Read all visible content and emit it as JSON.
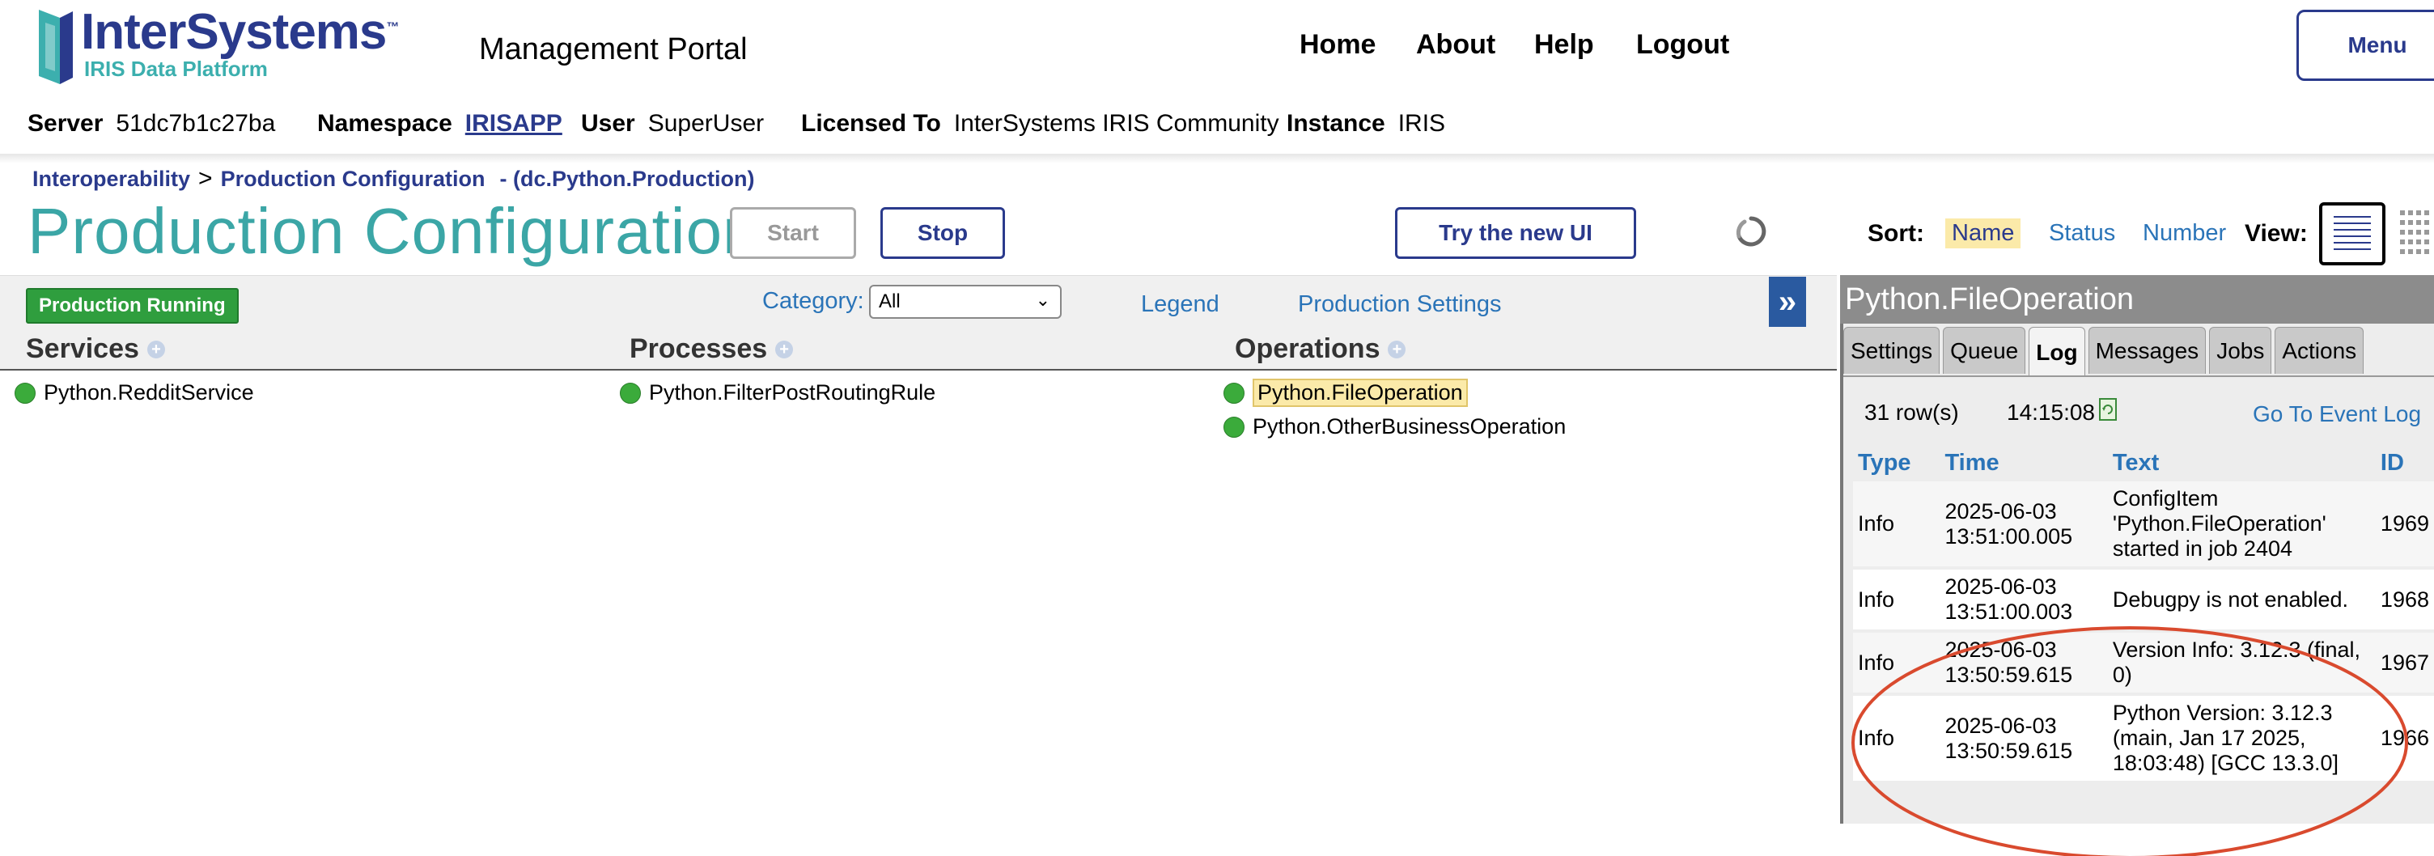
{
  "brand": {
    "name": "InterSystems",
    "tm": "™",
    "subtitle": "IRIS Data Platform",
    "portal_title": "Management Portal"
  },
  "topnav": [
    "Home",
    "About",
    "Help",
    "Logout"
  ],
  "menu_label": "Menu",
  "info": {
    "server_label": "Server",
    "server": "51dc7b1c27ba",
    "namespace_label": "Namespace",
    "namespace": "IRISAPP",
    "user_label": "User",
    "user": "SuperUser",
    "licensed_label": "Licensed To",
    "licensed": "InterSystems IRIS Community",
    "instance_label": "Instance",
    "instance": "IRIS"
  },
  "breadcrumb": {
    "root": "Interoperability",
    "separator": ">",
    "current": "Production Configuration",
    "suffix": "- (dc.Python.Production)"
  },
  "page_title": "Production Configuration",
  "buttons": {
    "start": "Start",
    "stop": "Stop",
    "new_ui": "Try the new UI"
  },
  "sort": {
    "label": "Sort:",
    "options": [
      "Name",
      "Status",
      "Number"
    ],
    "selected": "Name"
  },
  "view_label": "View:",
  "toolbar": {
    "status": "Production Running",
    "category_label": "Category:",
    "category_value": "All",
    "legend": "Legend",
    "production_settings": "Production Settings",
    "collapse": "»"
  },
  "columns": {
    "services": {
      "title": "Services",
      "items": [
        "Python.RedditService"
      ]
    },
    "processes": {
      "title": "Processes",
      "items": [
        "Python.FilterPostRoutingRule"
      ]
    },
    "operations": {
      "title": "Operations",
      "items": [
        "Python.FileOperation",
        "Python.OtherBusinessOperation"
      ],
      "selected": "Python.FileOperation"
    }
  },
  "status_color": "#3bab3b",
  "panel": {
    "title": "Python.FileOperation",
    "tabs": [
      "Settings",
      "Queue",
      "Log",
      "Messages",
      "Jobs",
      "Actions"
    ],
    "active_tab": "Log",
    "rows_info": "31 row(s)",
    "time": "14:15:08",
    "event_log_link": "Go To Event Log",
    "log_headers": [
      "Type",
      "Time",
      "Text",
      "ID"
    ],
    "log_rows": [
      {
        "type": "Info",
        "time": "2025-06-03 13:51:00.005",
        "text": "ConfigItem 'Python.FileOperation' started in job 2404",
        "id": "1969"
      },
      {
        "type": "Info",
        "time": "2025-06-03 13:51:00.003",
        "text": "Debugpy is not enabled.",
        "id": "1968"
      },
      {
        "type": "Info",
        "time": "2025-06-03 13:50:59.615",
        "text": "Version Info: 3.12.3 (final, 0)",
        "id": "1967"
      },
      {
        "type": "Info",
        "time": "2025-06-03 13:50:59.615",
        "text": "Python Version: 3.12.3 (main, Jan 17 2025, 18:03:48) [GCC 13.3.0]",
        "id": "1966"
      }
    ]
  },
  "annotation_color": "#d94a2e"
}
